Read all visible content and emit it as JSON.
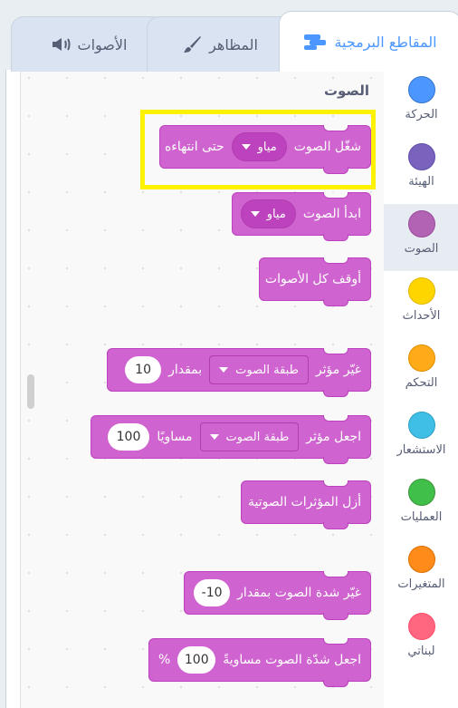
{
  "tabs": [
    {
      "label": "المقاطع البرمجية",
      "icon": "code-blocks-icon"
    },
    {
      "label": "المظاهر",
      "icon": "paintbrush-icon"
    },
    {
      "label": "الأصوات",
      "icon": "speaker-icon"
    }
  ],
  "categories": [
    {
      "label": "الحركة",
      "color": "#4c97ff"
    },
    {
      "label": "الهيئة",
      "color": "#9966ff"
    },
    {
      "label": "الصوت",
      "color": "#cf63cf"
    },
    {
      "label": "الأحداث",
      "color": "#ffbf00"
    },
    {
      "label": "التحكم",
      "color": "#ffab19"
    },
    {
      "label": "الاستشعار",
      "color": "#5cb1d6"
    },
    {
      "label": "العمليات",
      "color": "#59c059"
    },
    {
      "label": "المتغيرات",
      "color": "#ff8c1a"
    },
    {
      "label": "لبناتي",
      "color": "#ff6680"
    }
  ],
  "palette": {
    "section_title": "الصوت",
    "blocks": {
      "play_until_done": {
        "text1": "شغّل الصوت",
        "menu": "مياو",
        "text2": "حتى انتهاءه"
      },
      "start_sound": {
        "text1": "ابدأ الصوت",
        "menu": "مياو"
      },
      "stop_all": {
        "text1": "أوقف كل الأصوات"
      },
      "change_effect": {
        "text1": "غيّر مؤثر",
        "menu": "طبقة الصوت",
        "text2": "بمقدار",
        "value": "10"
      },
      "set_effect": {
        "text1": "اجعل مؤثر",
        "menu": "طبقة الصوت",
        "text2": "مساويًا",
        "value": "100"
      },
      "clear_effects": {
        "text1": "أزل المؤثرات الصوتية"
      },
      "change_volume": {
        "text1": "غيّر شدة الصوت بمقدار",
        "value": "-10"
      },
      "set_volume": {
        "text1": "اجعل شدّة الصوت مساويةً",
        "value": "100",
        "suffix": "%"
      }
    }
  },
  "colors": {
    "accent": "#4c97ff",
    "sound_block": "#cf63cf",
    "highlight": "#fef200"
  }
}
